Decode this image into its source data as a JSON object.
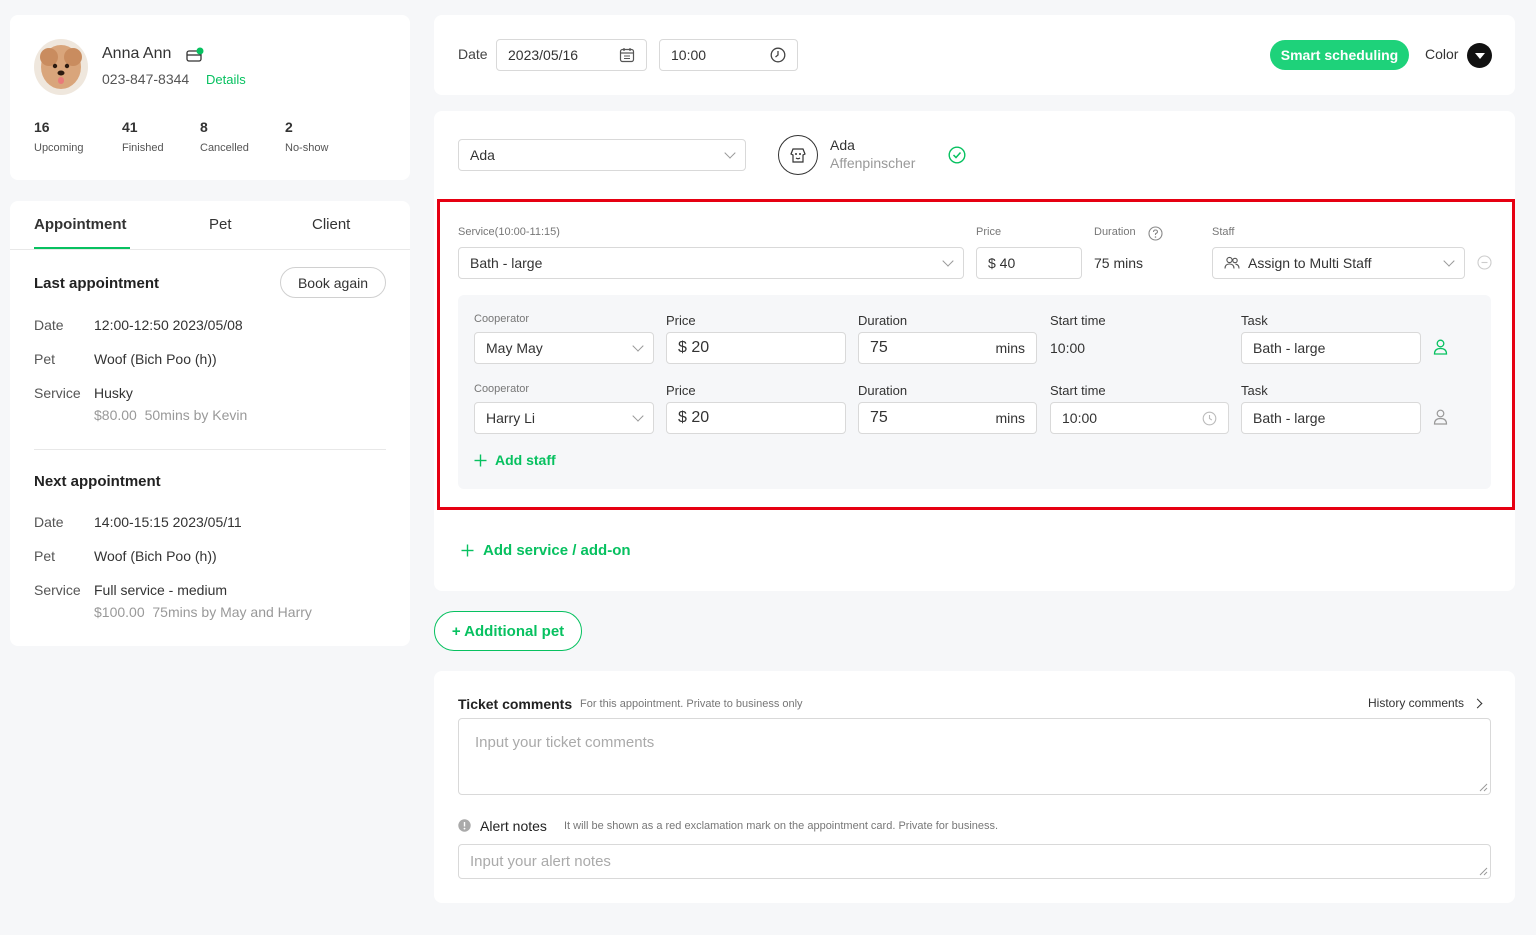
{
  "client": {
    "name": "Anna Ann",
    "phone": "023-847-8344",
    "details_link": "Details",
    "stats": [
      {
        "value": "16",
        "label": "Upcoming"
      },
      {
        "value": "41",
        "label": "Finished"
      },
      {
        "value": "8",
        "label": "Cancelled"
      },
      {
        "value": "2",
        "label": "No-show"
      }
    ]
  },
  "tabs": [
    "Appointment",
    "Pet",
    "Client"
  ],
  "last_appointment": {
    "heading": "Last appointment",
    "book_again": "Book again",
    "date_label": "Date",
    "date": "12:00-12:50 2023/05/08",
    "pet_label": "Pet",
    "pet": "Woof (Bich Poo (h))",
    "service_label": "Service",
    "service": "Husky",
    "service_detail": "$80.00  50mins by Kevin"
  },
  "next_appointment": {
    "heading": "Next appointment",
    "date_label": "Date",
    "date": "14:00-15:15 2023/05/11",
    "pet_label": "Pet",
    "pet": "Woof (Bich Poo (h))",
    "service_label": "Service",
    "service": "Full service - medium",
    "service_detail": "$100.00  75mins by May and Harry"
  },
  "schedule": {
    "date_label": "Date",
    "date": "2023/05/16",
    "time": "10:00",
    "smart_button": "Smart scheduling",
    "color_label": "Color"
  },
  "pet_select": {
    "value": "Ada",
    "pet_name": "Ada",
    "breed": "Affenpinscher"
  },
  "service": {
    "service_label": "Service(10:00-11:15)",
    "service_value": "Bath - large",
    "price_label": "Price",
    "price_value": "$ 40",
    "duration_label": "Duration",
    "duration_value": "75 mins",
    "staff_label": "Staff",
    "staff_value": "Assign to Multi Staff"
  },
  "cooperators": [
    {
      "cooperator_label": "Cooperator",
      "name": "May May",
      "price_label": "Price",
      "price": "$ 20",
      "duration_label": "Duration",
      "duration": "75",
      "duration_unit": "mins",
      "start_label": "Start time",
      "start": "10:00",
      "task_label": "Task",
      "task": "Bath - large"
    },
    {
      "cooperator_label": "Cooperator",
      "name": "Harry Li",
      "price_label": "Price",
      "price": "$ 20",
      "duration_label": "Duration",
      "duration": "75",
      "duration_unit": "mins",
      "start_label": "Start time",
      "start": "10:00",
      "task_label": "Task",
      "task": "Bath - large"
    }
  ],
  "add_staff": "Add staff",
  "add_service": "Add service / add-on",
  "additional_pet": "+ Additional pet",
  "comments": {
    "title": "Ticket comments",
    "subtitle": "For this appointment. Private to business only",
    "history": "History comments",
    "placeholder": "Input your ticket comments",
    "alert_title": "Alert notes",
    "alert_subtitle": "It will be shown as a red exclamation mark on the appointment card. Private for business.",
    "alert_placeholder": "Input your alert notes"
  },
  "colors": {
    "accent": "#07c160",
    "highlight": "#e60012"
  }
}
